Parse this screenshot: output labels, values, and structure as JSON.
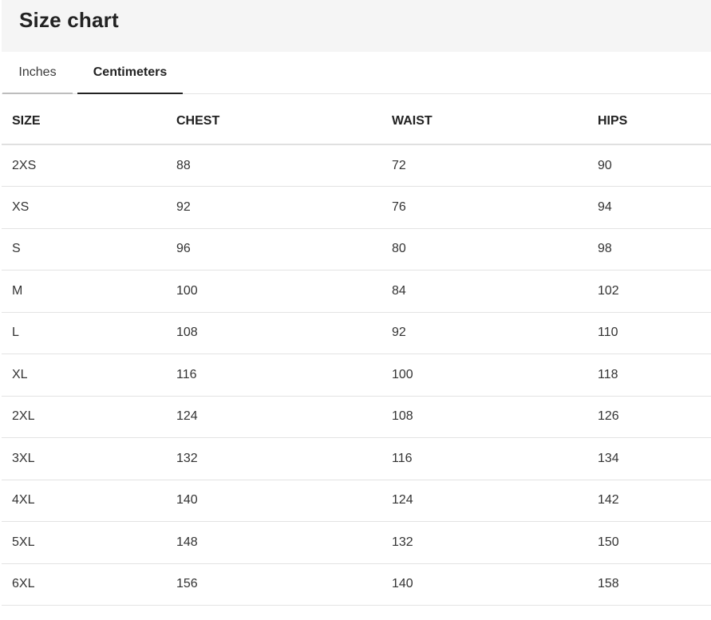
{
  "header": {
    "title": "Size chart"
  },
  "tabs": [
    {
      "label": "Inches",
      "active": false
    },
    {
      "label": "Centimeters",
      "active": true
    }
  ],
  "table": {
    "columns": [
      "SIZE",
      "CHEST",
      "WAIST",
      "HIPS"
    ],
    "rows": [
      [
        "2XS",
        "88",
        "72",
        "90"
      ],
      [
        "XS",
        "92",
        "76",
        "94"
      ],
      [
        "S",
        "96",
        "80",
        "98"
      ],
      [
        "M",
        "100",
        "84",
        "102"
      ],
      [
        "L",
        "108",
        "92",
        "110"
      ],
      [
        "XL",
        "116",
        "100",
        "118"
      ],
      [
        "2XL",
        "124",
        "108",
        "126"
      ],
      [
        "3XL",
        "132",
        "116",
        "134"
      ],
      [
        "4XL",
        "140",
        "124",
        "142"
      ],
      [
        "5XL",
        "148",
        "132",
        "150"
      ],
      [
        "6XL",
        "156",
        "140",
        "158"
      ]
    ]
  }
}
